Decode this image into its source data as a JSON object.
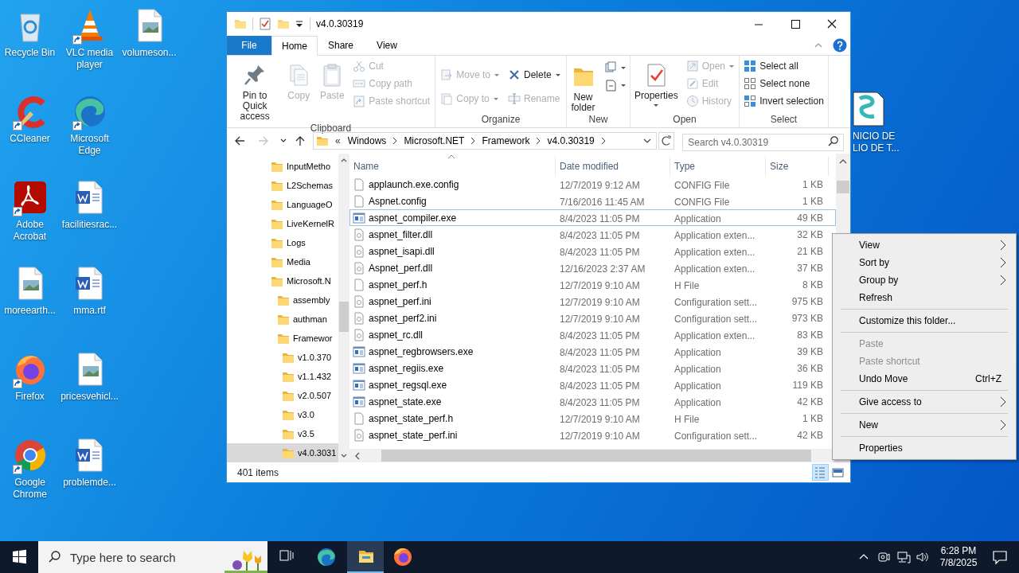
{
  "desktop_columns": [
    [
      {
        "label": "Recycle Bin",
        "shortcut": false
      },
      {
        "label": "CCleaner",
        "shortcut": true
      },
      {
        "label": "Adobe Acrobat",
        "shortcut": true
      },
      {
        "label": "moreearth...",
        "shortcut": false
      },
      {
        "label": "Firefox",
        "shortcut": true
      },
      {
        "label": "Google Chrome",
        "shortcut": true
      }
    ],
    [
      {
        "label": "VLC media player",
        "shortcut": true
      },
      {
        "label": "Microsoft Edge",
        "shortcut": true
      },
      {
        "label": "facilitiesrac...",
        "shortcut": false
      },
      {
        "label": "mma.rtf",
        "shortcut": false
      },
      {
        "label": "pricesvehicl...",
        "shortcut": false
      },
      {
        "label": "problemde...",
        "shortcut": false
      }
    ],
    [
      {
        "label": "volumeson...",
        "shortcut": false
      }
    ]
  ],
  "desktop_edge_icon": {
    "lines": [
      "NICIO DE",
      "LIO DE T..."
    ]
  },
  "explorer": {
    "title": "v4.0.30319",
    "ribbon_tabs": [
      {
        "label": "File",
        "kind": "file",
        "selected": false
      },
      {
        "label": "Home",
        "kind": "tab",
        "selected": true
      },
      {
        "label": "Share",
        "kind": "tab",
        "selected": false
      },
      {
        "label": "View",
        "kind": "tab",
        "selected": false
      }
    ],
    "ribbon_groups": [
      {
        "label": "Clipboard",
        "columns": [
          [
            {
              "label": "Pin to Quick access",
              "kind": "large",
              "disabled": false,
              "dropdown": false
            }
          ],
          [
            {
              "label": "Copy",
              "kind": "large",
              "disabled": true,
              "dropdown": false
            }
          ],
          [
            {
              "label": "Paste",
              "kind": "large",
              "disabled": true,
              "dropdown": false
            }
          ],
          [
            {
              "label": "Cut",
              "kind": "small",
              "disabled": true,
              "dropdown": false
            },
            {
              "label": "Copy path",
              "kind": "small",
              "disabled": true,
              "dropdown": false
            },
            {
              "label": "Paste shortcut",
              "kind": "small",
              "disabled": true,
              "dropdown": false
            }
          ]
        ]
      },
      {
        "label": "Organize",
        "columns": [
          [
            {
              "label": "Move to",
              "kind": "small",
              "disabled": true,
              "dropdown": true
            },
            {
              "label": "Copy to",
              "kind": "small",
              "disabled": true,
              "dropdown": true
            }
          ],
          [
            {
              "label": "Delete",
              "kind": "small",
              "disabled": false,
              "dropdown": true
            },
            {
              "label": "Rename",
              "kind": "small",
              "disabled": true,
              "dropdown": false
            }
          ]
        ]
      },
      {
        "label": "New",
        "columns": [
          [
            {
              "label": "New folder",
              "kind": "large",
              "disabled": false,
              "dropdown": false
            }
          ],
          [
            {
              "kind": "small",
              "disabled": false,
              "dropdown": true
            },
            {
              "kind": "small",
              "disabled": false,
              "dropdown": true
            }
          ]
        ]
      },
      {
        "label": "Open",
        "columns": [
          [
            {
              "label": "Properties",
              "kind": "large",
              "disabled": false,
              "dropdown": true
            }
          ],
          [
            {
              "label": "Open",
              "kind": "small",
              "disabled": true,
              "dropdown": true
            },
            {
              "label": "Edit",
              "kind": "small",
              "disabled": true,
              "dropdown": false
            },
            {
              "label": "History",
              "kind": "small",
              "disabled": true,
              "dropdown": false
            }
          ]
        ]
      },
      {
        "label": "Select",
        "columns": [
          [
            {
              "label": "Select all",
              "kind": "small",
              "disabled": false,
              "dropdown": false
            },
            {
              "label": "Select none",
              "kind": "small",
              "disabled": false,
              "dropdown": false
            },
            {
              "label": "Invert selection",
              "kind": "small",
              "disabled": false,
              "dropdown": false
            }
          ]
        ]
      }
    ],
    "nav_buttons": [
      {
        "disabled": false
      },
      {
        "disabled": true
      },
      {
        "disabled": false
      },
      {
        "disabled": false
      }
    ],
    "address": {
      "overflow_mark": "«",
      "crumbs": [
        "Windows",
        "Microsoft.NET",
        "Framework",
        "v4.0.30319"
      ]
    },
    "search": {
      "placeholder": "Search v4.0.30319"
    },
    "nav_tree": [
      {
        "label": "InputMetho",
        "selected": false
      },
      {
        "label": "L2Schemas",
        "selected": false
      },
      {
        "label": "LanguageO",
        "selected": false
      },
      {
        "label": "LiveKernelR",
        "selected": false
      },
      {
        "label": "Logs",
        "selected": false
      },
      {
        "label": "Media",
        "selected": false
      },
      {
        "label": "Microsoft.N",
        "selected": false,
        "children": [
          {
            "label": "assembly",
            "selected": false
          },
          {
            "label": "authman",
            "selected": false
          },
          {
            "label": "Framewor",
            "selected": false,
            "children": [
              {
                "label": "v1.0.370",
                "selected": false
              },
              {
                "label": "v1.1.432",
                "selected": false
              },
              {
                "label": "v2.0.507",
                "selected": false
              },
              {
                "label": "v3.0",
                "selected": false
              },
              {
                "label": "v3.5",
                "selected": false
              },
              {
                "label": "v4.0.3031",
                "selected": true
              }
            ]
          }
        ]
      }
    ],
    "columns": [
      {
        "label": "Name",
        "sorted": true
      },
      {
        "label": "Date modified",
        "sorted": false
      },
      {
        "label": "Type",
        "sorted": false
      },
      {
        "label": "Size",
        "sorted": false
      }
    ],
    "rows": [
      {
        "name": "applaunch.exe.config",
        "date": "12/7/2019 9:12 AM",
        "type": "CONFIG File",
        "size": "1 KB",
        "focused": false
      },
      {
        "name": "Aspnet.config",
        "date": "7/16/2016 11:45 AM",
        "type": "CONFIG File",
        "size": "1 KB",
        "focused": false
      },
      {
        "name": "aspnet_compiler.exe",
        "date": "8/4/2023 11:05 PM",
        "type": "Application",
        "size": "49 KB",
        "focused": true
      },
      {
        "name": "aspnet_filter.dll",
        "date": "8/4/2023 11:05 PM",
        "type": "Application exten...",
        "size": "32 KB",
        "focused": false
      },
      {
        "name": "aspnet_isapi.dll",
        "date": "8/4/2023 11:05 PM",
        "type": "Application exten...",
        "size": "21 KB",
        "focused": false
      },
      {
        "name": "Aspnet_perf.dll",
        "date": "12/16/2023 2:37 AM",
        "type": "Application exten...",
        "size": "37 KB",
        "focused": false
      },
      {
        "name": "aspnet_perf.h",
        "date": "12/7/2019 9:10 AM",
        "type": "H File",
        "size": "8 KB",
        "focused": false
      },
      {
        "name": "aspnet_perf.ini",
        "date": "12/7/2019 9:10 AM",
        "type": "Configuration sett...",
        "size": "975 KB",
        "focused": false
      },
      {
        "name": "aspnet_perf2.ini",
        "date": "12/7/2019 9:10 AM",
        "type": "Configuration sett...",
        "size": "973 KB",
        "focused": false
      },
      {
        "name": "aspnet_rc.dll",
        "date": "8/4/2023 11:05 PM",
        "type": "Application exten...",
        "size": "83 KB",
        "focused": false
      },
      {
        "name": "aspnet_regbrowsers.exe",
        "date": "8/4/2023 11:05 PM",
        "type": "Application",
        "size": "39 KB",
        "focused": false
      },
      {
        "name": "aspnet_regiis.exe",
        "date": "8/4/2023 11:05 PM",
        "type": "Application",
        "size": "36 KB",
        "focused": false
      },
      {
        "name": "aspnet_regsql.exe",
        "date": "8/4/2023 11:05 PM",
        "type": "Application",
        "size": "119 KB",
        "focused": false
      },
      {
        "name": "aspnet_state.exe",
        "date": "8/4/2023 11:05 PM",
        "type": "Application",
        "size": "42 KB",
        "focused": false
      },
      {
        "name": "aspnet_state_perf.h",
        "date": "12/7/2019 9:10 AM",
        "type": "H File",
        "size": "1 KB",
        "focused": false
      },
      {
        "name": "aspnet_state_perf.ini",
        "date": "12/7/2019 9:10 AM",
        "type": "Configuration sett...",
        "size": "42 KB",
        "focused": false
      }
    ],
    "status": "401 items",
    "view_buttons": [
      {
        "selected": true
      },
      {
        "selected": false
      }
    ]
  },
  "context_menu": [
    {
      "kind": "item",
      "label": "View",
      "disabled": false,
      "submenu": true
    },
    {
      "kind": "item",
      "label": "Sort by",
      "disabled": false,
      "submenu": true
    },
    {
      "kind": "item",
      "label": "Group by",
      "disabled": false,
      "submenu": true
    },
    {
      "kind": "item",
      "label": "Refresh",
      "disabled": false,
      "submenu": false
    },
    {
      "kind": "separator"
    },
    {
      "kind": "item",
      "label": "Customize this folder...",
      "disabled": false,
      "submenu": false
    },
    {
      "kind": "separator"
    },
    {
      "kind": "item",
      "label": "Paste",
      "disabled": true,
      "submenu": false
    },
    {
      "kind": "item",
      "label": "Paste shortcut",
      "disabled": true,
      "submenu": false
    },
    {
      "kind": "item",
      "label": "Undo Move",
      "disabled": false,
      "submenu": false,
      "shortcut": "Ctrl+Z"
    },
    {
      "kind": "separator"
    },
    {
      "kind": "item",
      "label": "Give access to",
      "disabled": false,
      "submenu": true
    },
    {
      "kind": "separator"
    },
    {
      "kind": "item",
      "label": "New",
      "disabled": false,
      "submenu": true
    },
    {
      "kind": "separator"
    },
    {
      "kind": "item",
      "label": "Properties",
      "disabled": false,
      "submenu": false
    }
  ],
  "taskbar": {
    "search_placeholder": "Type here to search",
    "apps": [
      {
        "active": false
      },
      {
        "active": false
      },
      {
        "active": true
      },
      {
        "active": false
      }
    ],
    "time": "6:28 PM",
    "date": "7/8/2025"
  }
}
